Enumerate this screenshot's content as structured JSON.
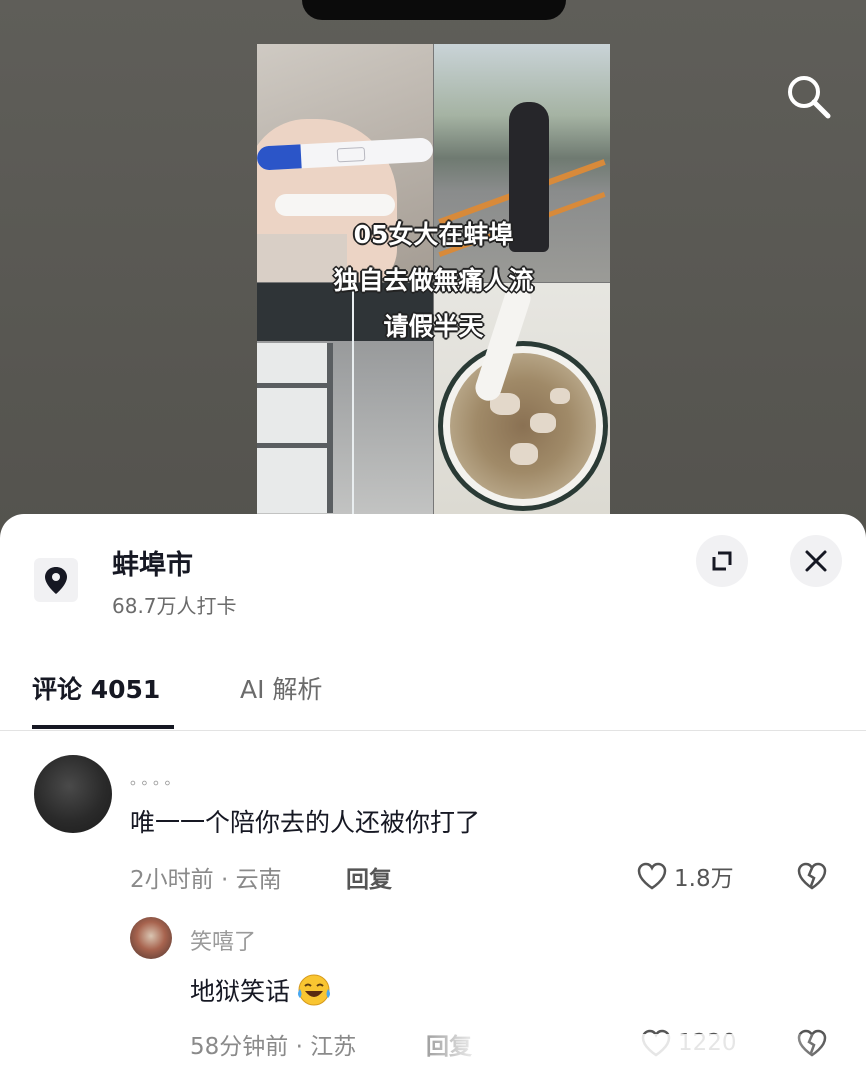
{
  "video": {
    "caption_lines": [
      "05女大在蚌埠",
      "独自去做無痛人流",
      "请假半天"
    ]
  },
  "location": {
    "name": "蚌埠市",
    "checkins": "68.7万人打卡"
  },
  "tabs": [
    {
      "label": "评论 4051",
      "active": true
    },
    {
      "label": "AI 解析",
      "active": false
    }
  ],
  "comments": [
    {
      "username": "。。。。",
      "text": "唯一一个陪你去的人还被你打了",
      "meta": "2小时前 · 云南",
      "reply_label": "回复",
      "likes": "1.8万"
    },
    {
      "username": "笑嘻了",
      "text": "地狱笑话",
      "meta": "58分钟前 · 江苏",
      "reply_label": "回复",
      "likes": "1220"
    }
  ],
  "icons": {
    "search": "search-icon",
    "location": "location-pin-icon",
    "expand": "expand-icon",
    "close": "close-icon",
    "like": "heart-outline-icon",
    "dislike": "broken-heart-icon",
    "emoji": "laughing-crying-emoji-icon"
  },
  "colors": {
    "text_primary": "#161823",
    "text_secondary": "#8a8a8a",
    "sheet_bg": "#ffffff",
    "background": "#55544f"
  }
}
